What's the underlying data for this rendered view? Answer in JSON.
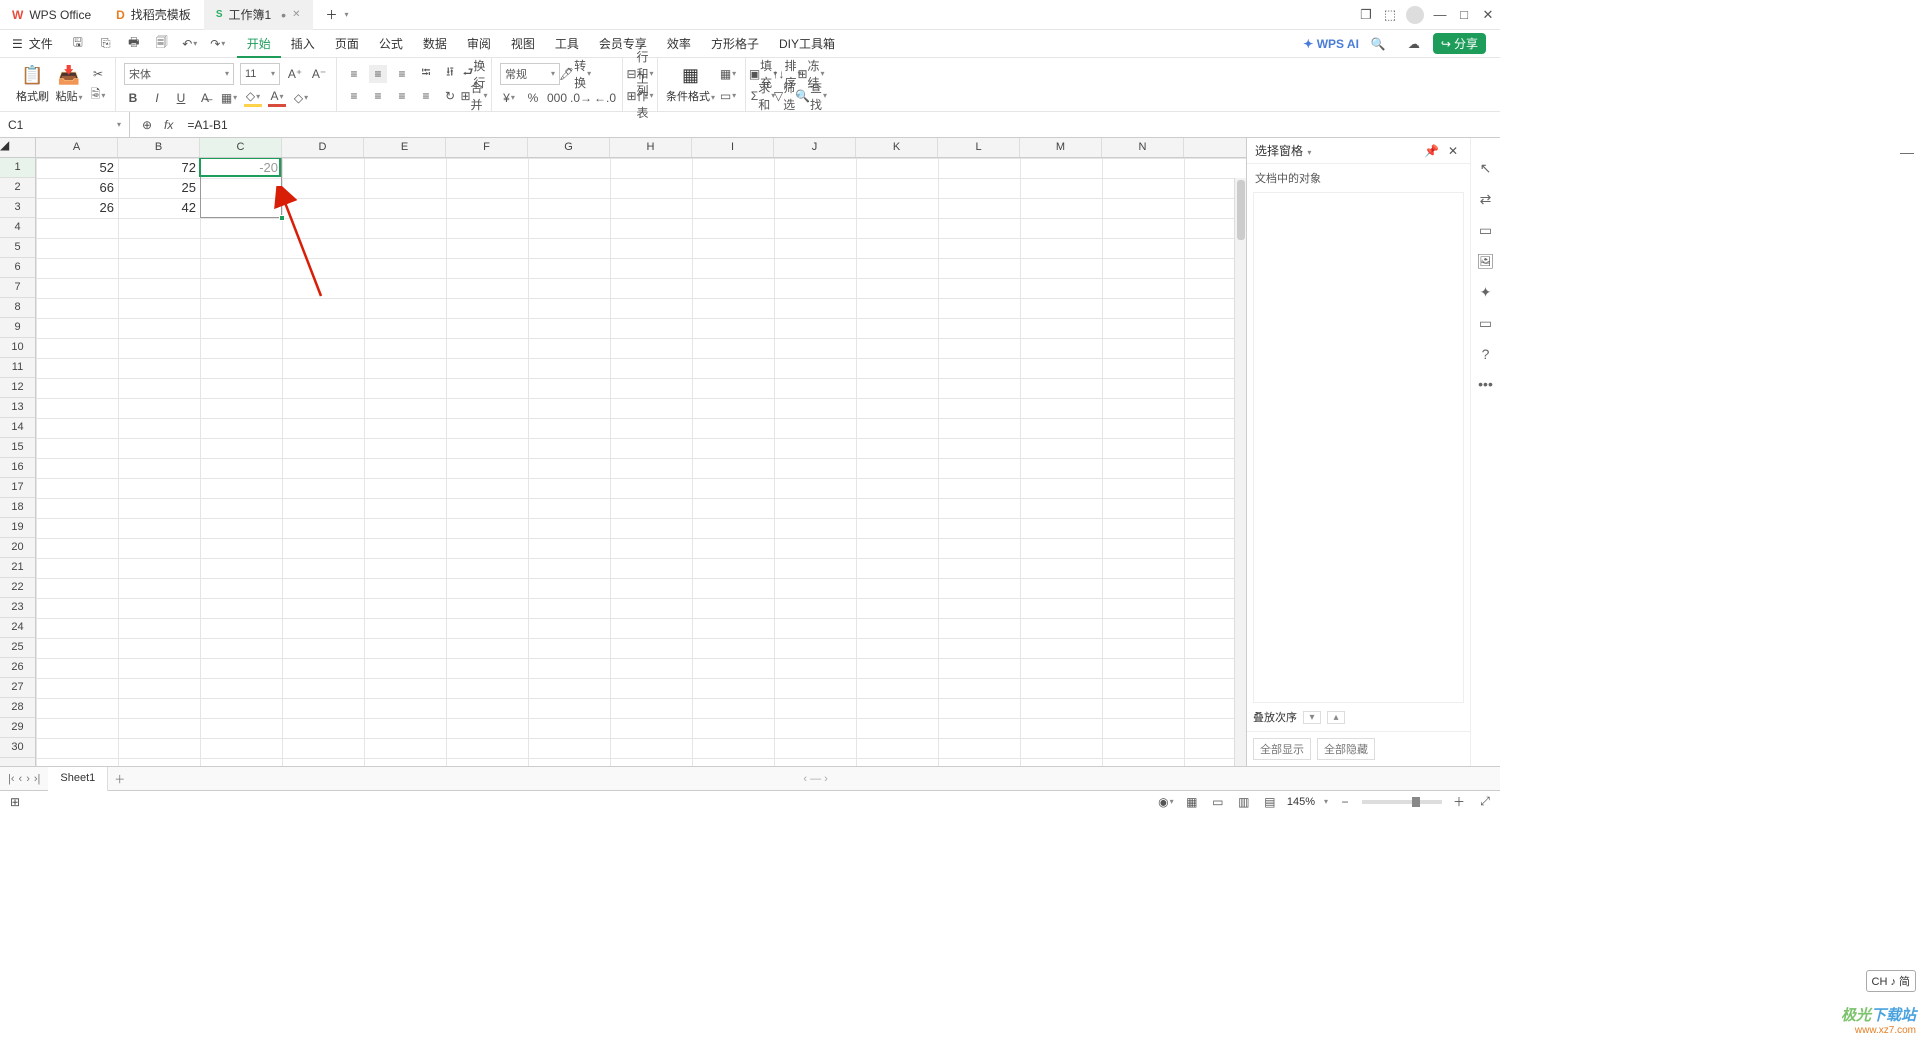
{
  "title_tabs": {
    "wps_office": "WPS Office",
    "find_template": "找稻壳模板",
    "workbook": "工作簿1"
  },
  "menu": {
    "file": "文件",
    "tabs": [
      "开始",
      "插入",
      "页面",
      "公式",
      "数据",
      "审阅",
      "视图",
      "工具",
      "会员专享",
      "效率",
      "方形格子",
      "DIY工具箱"
    ],
    "wpsai": "WPS AI",
    "share": "分享"
  },
  "ribbon": {
    "format_painter": "格式刷",
    "paste": "粘贴",
    "font_name": "宋体",
    "font_size": "11",
    "wrap": "换行",
    "merge": "合并",
    "normal": "常规",
    "transform": "转换",
    "rows_cols": "行和列",
    "worksheet": "工作表",
    "cond_format": "条件格式",
    "fill": "填充",
    "sort": "排序",
    "freeze": "冻结",
    "sum": "求和",
    "filter": "筛选",
    "find": "查找"
  },
  "formula_bar": {
    "name": "C1",
    "fx_label": "fx",
    "formula": "=A1-B1"
  },
  "columns": [
    "A",
    "B",
    "C",
    "D",
    "E",
    "F",
    "G",
    "H",
    "I",
    "J",
    "K",
    "L",
    "M",
    "N"
  ],
  "row_count": 30,
  "data": {
    "A": {
      "1": "52",
      "2": "66",
      "3": "26"
    },
    "B": {
      "1": "72",
      "2": "25",
      "3": "42"
    },
    "C": {
      "1": "-20"
    }
  },
  "side_panel": {
    "title": "选择窗格",
    "subtitle": "文档中的对象",
    "stack_order": "叠放次序",
    "show_all": "全部显示",
    "hide_all": "全部隐藏"
  },
  "sheet": {
    "name": "Sheet1"
  },
  "status": {
    "zoom": "145%",
    "ime": "CH ♪ 简"
  },
  "watermark": {
    "line1a": "极光",
    "line1b": "下载站",
    "line2": "www.xz7.com"
  }
}
